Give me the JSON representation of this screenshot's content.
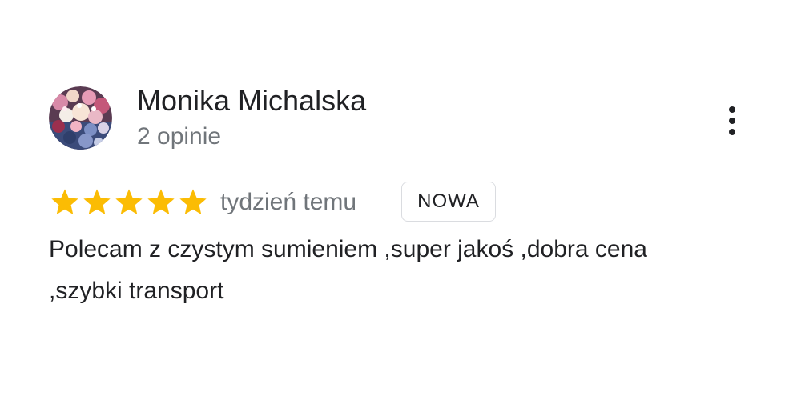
{
  "reviewer": {
    "name": "Monika Michalska",
    "reviews_count": "2 opinie",
    "avatar": "avatar-photo"
  },
  "menu": {
    "icon": "more-vertical-icon"
  },
  "rating": {
    "stars": 5,
    "max_stars": 5,
    "star_color": "#fbbc04",
    "icon": "star-icon"
  },
  "review": {
    "date": "tydzień temu",
    "badge": "NOWA",
    "text": "Polecam z czystym sumieniem ,super jakoś ,dobra cena ,szybki transport"
  },
  "colors": {
    "primary_text": "#202124",
    "secondary_text": "#70757a",
    "badge_border": "#dadce0"
  }
}
